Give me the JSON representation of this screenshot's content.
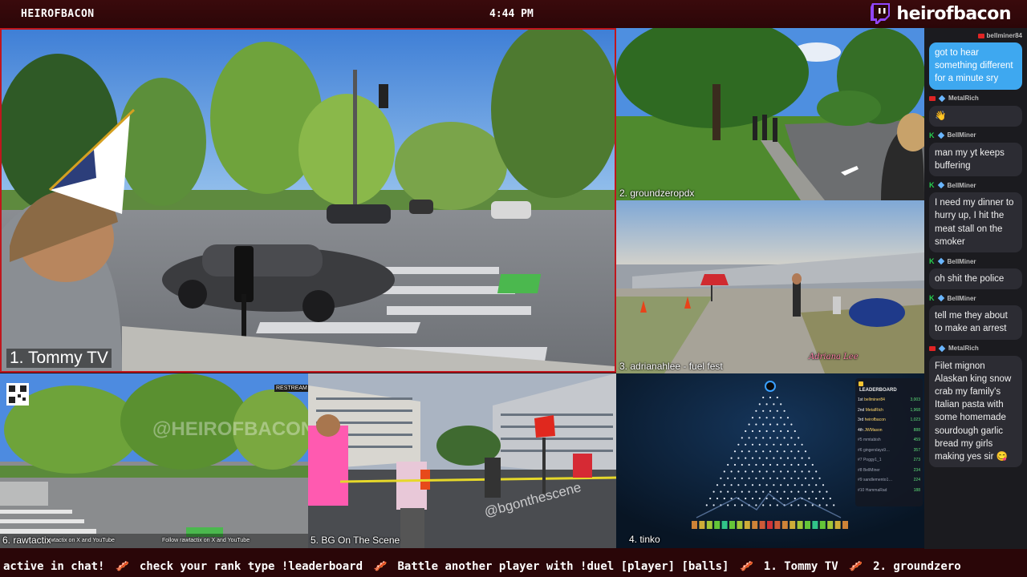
{
  "topbar": {
    "left_label": "HEIROFBACON",
    "clock": "4:44 PM",
    "channel": "heirofbacon",
    "brand_color": "#9146ff"
  },
  "streams": [
    {
      "id": "p1",
      "label": "1. Tommy TV"
    },
    {
      "id": "p2",
      "label": "2. groundzeropdx"
    },
    {
      "id": "p3",
      "label": "3. adrianahlee - fuel fest"
    },
    {
      "id": "p4",
      "label": "4. tinko"
    },
    {
      "id": "p5",
      "label": "5. BG On The Scene"
    },
    {
      "id": "p6",
      "label": "6. rawtactix"
    }
  ],
  "overlays": {
    "p6_watermark": "@HEIROFBACON",
    "p6_restream": "RESTREAM",
    "p6_footer1": "rawtactix on X and YouTube",
    "p6_footer2": "Follow rawtactix on X and YouTube",
    "p5_watermark": "@bgonthescene",
    "p3_watermark": "Adriana Lee",
    "p4_leaderboard_title": "LEADERBOARD"
  },
  "leaderboard": [
    {
      "rank": "1st",
      "name": "bellminer84",
      "score": "3,003"
    },
    {
      "rank": "2nd",
      "name": "MetalRich",
      "score": "1,968"
    },
    {
      "rank": "3rd",
      "name": "heirofbacon",
      "score": "1,023"
    },
    {
      "rank": "4th",
      "name": "JWMason",
      "score": "888"
    },
    {
      "rank": "#5",
      "name": "mmtabish",
      "score": "459"
    },
    {
      "rank": "#6",
      "name": "gingerslays9…",
      "score": "357"
    },
    {
      "rank": "#7",
      "name": "Poggy1_1",
      "score": "273"
    },
    {
      "rank": "#8",
      "name": "BellMiner",
      "score": "234"
    },
    {
      "rank": "#9",
      "name": "sandlemento1…",
      "score": "224"
    },
    {
      "rank": "#10",
      "name": "HammaRad",
      "score": "188"
    }
  ],
  "chat": {
    "top_user": "bellminer84",
    "messages": [
      {
        "user": "",
        "badge": "none",
        "text": "got to hear something different for a minute sry",
        "own": true
      },
      {
        "user": "MetalRich",
        "badge": "yt",
        "text": "👋",
        "own": false
      },
      {
        "user": "BellMiner",
        "badge": "k",
        "text": "man my yt keeps buffering",
        "own": false
      },
      {
        "user": "BellMiner",
        "badge": "k",
        "text": "I need my dinner to hurry up, I hit the meat stall on the smoker",
        "own": false
      },
      {
        "user": "BellMiner",
        "badge": "k",
        "text": "oh shit the police",
        "own": false
      },
      {
        "user": "BellMiner",
        "badge": "k",
        "text": "tell me they about to make an arrest",
        "own": false
      },
      {
        "user": "MetalRich",
        "badge": "yt",
        "text": "Filet mignon Alaskan king snow crab my family's Italian pasta with some homemade sourdough garlic bread my girls making yes sir 😋",
        "own": false
      }
    ]
  },
  "ticker": [
    "active in chat!",
    "check your rank type !leaderboard",
    "Battle another player with !duel [player] [balls]",
    "1. Tommy TV",
    "2. groundzero"
  ]
}
